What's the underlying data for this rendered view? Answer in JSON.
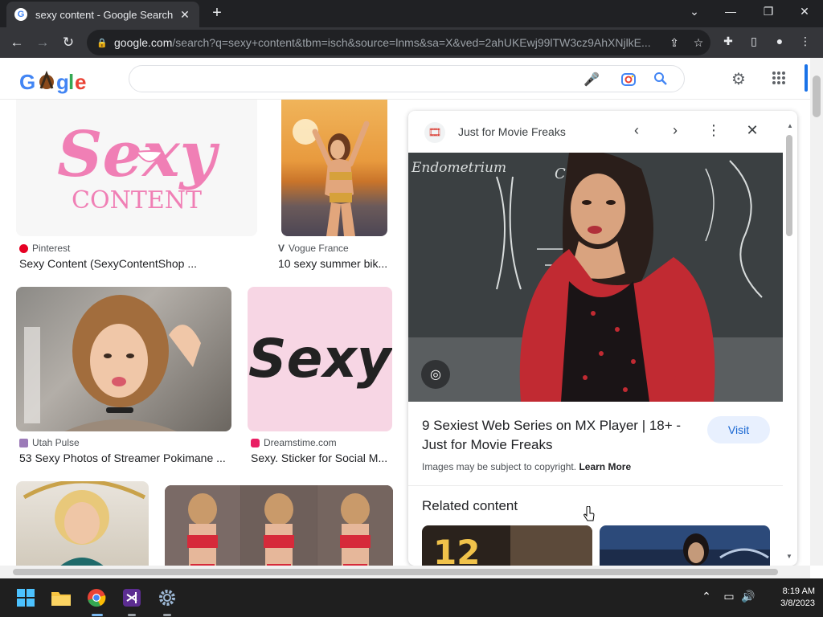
{
  "browser": {
    "tab_title": "sexy content - Google Search",
    "url_host": "google.com",
    "url_rest": "/search?q=sexy+content&tbm=isch&source=lnms&sa=X&ved=2ahUKEwj99lTW3cz9AhXNjlkE..."
  },
  "google": {
    "logo_text": "Google",
    "search_value": "",
    "colors": {
      "blue": "#4285f4",
      "red": "#ea4335",
      "yellow": "#fbbc05",
      "green": "#34a853"
    }
  },
  "results": [
    {
      "source": "Pinterest",
      "caption": "Sexy Content (SexyContentShop ...",
      "thumb_text": "Sexy",
      "thumb_sub": "CONTENT",
      "source_color": "#e60023"
    },
    {
      "source": "Vogue France",
      "caption": "10 sexy summer bik...",
      "source_color": "#000000"
    },
    {
      "source": "Utah Pulse",
      "caption": "53 Sexy Photos of Streamer Pokimane ...",
      "source_color": "#9c27b0"
    },
    {
      "source": "Dreamstime.com",
      "caption": "Sexy. Sticker for Social M...",
      "thumb_text": "Sexy",
      "source_color": "#e91e63"
    }
  ],
  "preview": {
    "source_name": "Just for Movie Freaks",
    "board_text_1": "Endometrium",
    "board_text_2": "Cer",
    "title": "9 Sexiest Web Series on MX Player | 18+ - Just for Movie Freaks",
    "visit_label": "Visit",
    "copyright_text": "Images may be subject to copyright.",
    "learn_more": "Learn More",
    "related_heading": "Related content",
    "related_1_text": "12"
  },
  "taskbar": {
    "time": "8:19 AM",
    "date": "3/8/2023"
  }
}
